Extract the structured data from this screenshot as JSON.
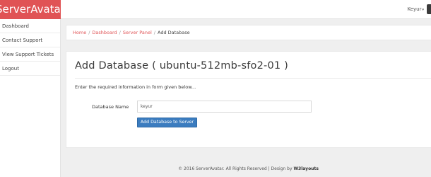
{
  "brand": {
    "name": "ServerAvatar"
  },
  "topbar": {
    "user_name": "Keyur",
    "caret": "▾"
  },
  "sidebar": {
    "items": [
      {
        "label": "Dashboard"
      },
      {
        "label": "Contact Support"
      },
      {
        "label": "View Support Tickets"
      },
      {
        "label": "Logout"
      }
    ]
  },
  "breadcrumb": {
    "items": [
      {
        "label": "Home"
      },
      {
        "label": "Dashboard"
      },
      {
        "label": "Server Panel"
      }
    ],
    "current": "Add Database",
    "separator": "/"
  },
  "main": {
    "title": "Add Database ( ubuntu-512mb-sfo2-01 )",
    "instructions": "Enter the required information in form given below...",
    "form": {
      "database_name_label": "Database Name",
      "database_name_value": "keyur",
      "submit_label": "Add Database to Server"
    }
  },
  "footer": {
    "text": "© 2016 ServerAvatar. All Rights Reserved | Design by ",
    "brand": "W3layouts"
  },
  "colors": {
    "brand_red": "#e05355",
    "primary_blue": "#3b7cbf"
  }
}
